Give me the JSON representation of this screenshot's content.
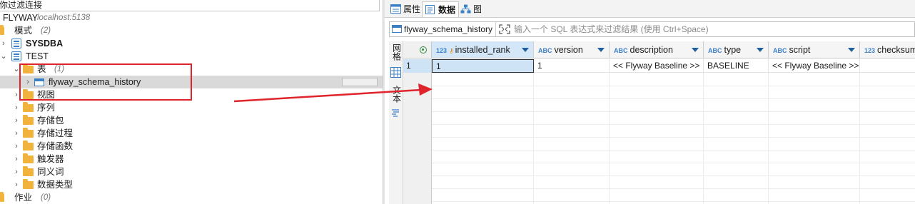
{
  "navigator": {
    "filter_text": "你过滤连接",
    "connection": {
      "name": "FLYWAY",
      "host": "localhost:5138"
    },
    "items": [
      {
        "label": "模式",
        "meta": "(2)"
      },
      {
        "label": "SYSDBA"
      },
      {
        "label": "TEST"
      },
      {
        "label": "表",
        "meta": "(1)"
      },
      {
        "label": "flyway_schema_history"
      },
      {
        "label": "视图"
      },
      {
        "label": "序列"
      },
      {
        "label": "存储包"
      },
      {
        "label": "存储过程"
      },
      {
        "label": "存储函数"
      },
      {
        "label": "触发器"
      },
      {
        "label": "同义词"
      },
      {
        "label": "数据类型"
      },
      {
        "label": "作业",
        "meta": "(0)"
      }
    ]
  },
  "editor": {
    "tabs": [
      {
        "label": "属性",
        "icon": "properties-icon"
      },
      {
        "label": "数据",
        "icon": "data-icon",
        "active": true
      },
      {
        "label": "图",
        "icon": "diagram-icon"
      }
    ],
    "filter_bar": {
      "table_name": "flyway_schema_history",
      "placeholder": "输入一个 SQL 表达式来过滤结果 (使用 Ctrl+Space)"
    },
    "side_toolbar": {
      "grid_label": "网格",
      "text_label": "文本"
    },
    "grid": {
      "columns": [
        {
          "type": "123",
          "name": "installed_rank",
          "sorted": true
        },
        {
          "type": "ABC",
          "name": "version"
        },
        {
          "type": "ABC",
          "name": "description"
        },
        {
          "type": "ABC",
          "name": "type"
        },
        {
          "type": "ABC",
          "name": "script"
        },
        {
          "type": "123",
          "name": "checksum"
        }
      ],
      "rows": [
        {
          "row_number": "1",
          "cells": [
            "1",
            "1",
            "<< Flyway Baseline >>",
            "BASELINE",
            "<< Flyway Baseline >>",
            ""
          ]
        }
      ]
    }
  },
  "colors": {
    "annotation_red": "#e0242b",
    "folder": "#f2b33d",
    "accent_blue": "#3b7fc4",
    "selected_row": "#d9d9d9"
  }
}
